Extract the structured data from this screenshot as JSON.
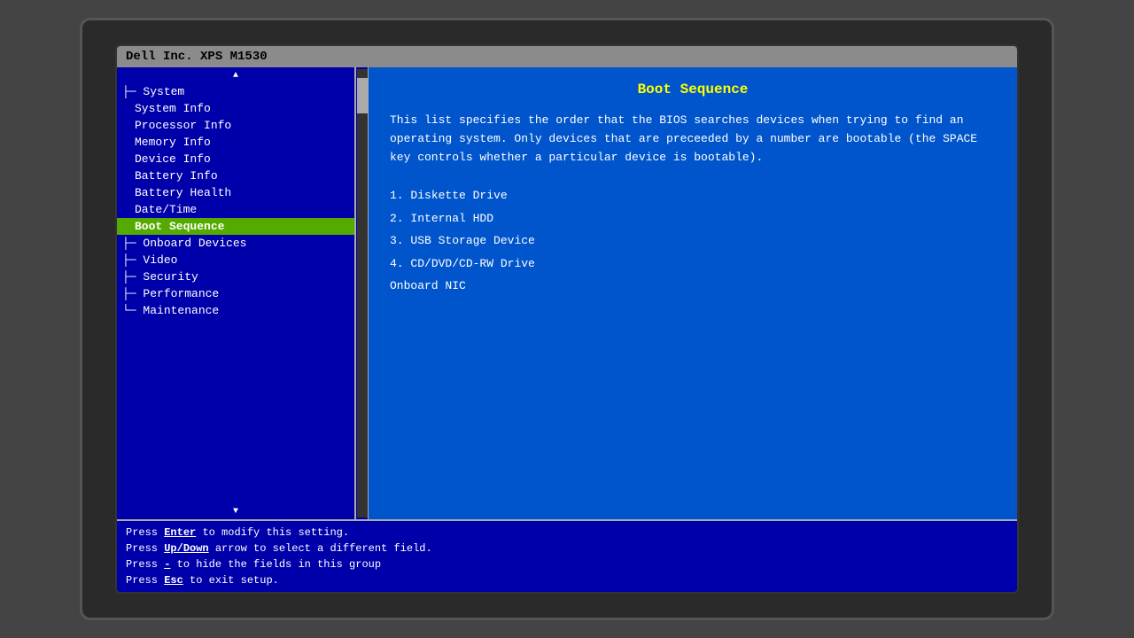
{
  "window": {
    "title": "Dell Inc. XPS M1530"
  },
  "nav": {
    "scroll_up": "▲",
    "scroll_down": "▼",
    "items": [
      {
        "id": "system",
        "label": "System",
        "level": "root",
        "prefix": "─",
        "selected": false
      },
      {
        "id": "system-info",
        "label": "System Info",
        "level": "sub",
        "selected": false
      },
      {
        "id": "processor-info",
        "label": "Processor Info",
        "level": "sub",
        "selected": false
      },
      {
        "id": "memory-info",
        "label": "Memory Info",
        "level": "sub",
        "selected": false
      },
      {
        "id": "device-info",
        "label": "Device Info",
        "level": "sub",
        "selected": false
      },
      {
        "id": "battery-info",
        "label": "Battery Info",
        "level": "sub",
        "selected": false
      },
      {
        "id": "battery-health",
        "label": "Battery Health",
        "level": "sub",
        "selected": false
      },
      {
        "id": "date-time",
        "label": "Date/Time",
        "level": "sub",
        "selected": false
      },
      {
        "id": "boot-sequence",
        "label": "Boot Sequence",
        "level": "sub",
        "selected": true
      },
      {
        "id": "onboard-devices",
        "label": "Onboard Devices",
        "level": "root2",
        "selected": false
      },
      {
        "id": "video",
        "label": "Video",
        "level": "root2",
        "selected": false
      },
      {
        "id": "security",
        "label": "Security",
        "level": "root2",
        "selected": false
      },
      {
        "id": "performance",
        "label": "Performance",
        "level": "root2",
        "selected": false
      },
      {
        "id": "maintenance",
        "label": "Maintenance",
        "level": "root2",
        "selected": false
      }
    ]
  },
  "content": {
    "title": "Boot Sequence",
    "description": "This list specifies the order that the BIOS searches devices when trying to find an operating system. Only devices that are preceeded by a number are bootable (the SPACE key controls whether a particular device is bootable).",
    "boot_devices": [
      {
        "number": "1.",
        "name": "Diskette Drive"
      },
      {
        "number": "2.",
        "name": "Internal HDD"
      },
      {
        "number": "3.",
        "name": "USB Storage Device"
      },
      {
        "number": "4.",
        "name": "CD/DVD/CD-RW Drive"
      },
      {
        "number": "",
        "name": "Onboard NIC"
      }
    ]
  },
  "status_bar": {
    "lines": [
      "Press Enter to modify this setting.",
      "Press Up/Down arrow to select a different field.",
      "Press - to hide the fields in this group",
      "Press Esc to exit setup."
    ],
    "keys": [
      "Enter",
      "Up/Down",
      "-",
      "Esc"
    ]
  }
}
